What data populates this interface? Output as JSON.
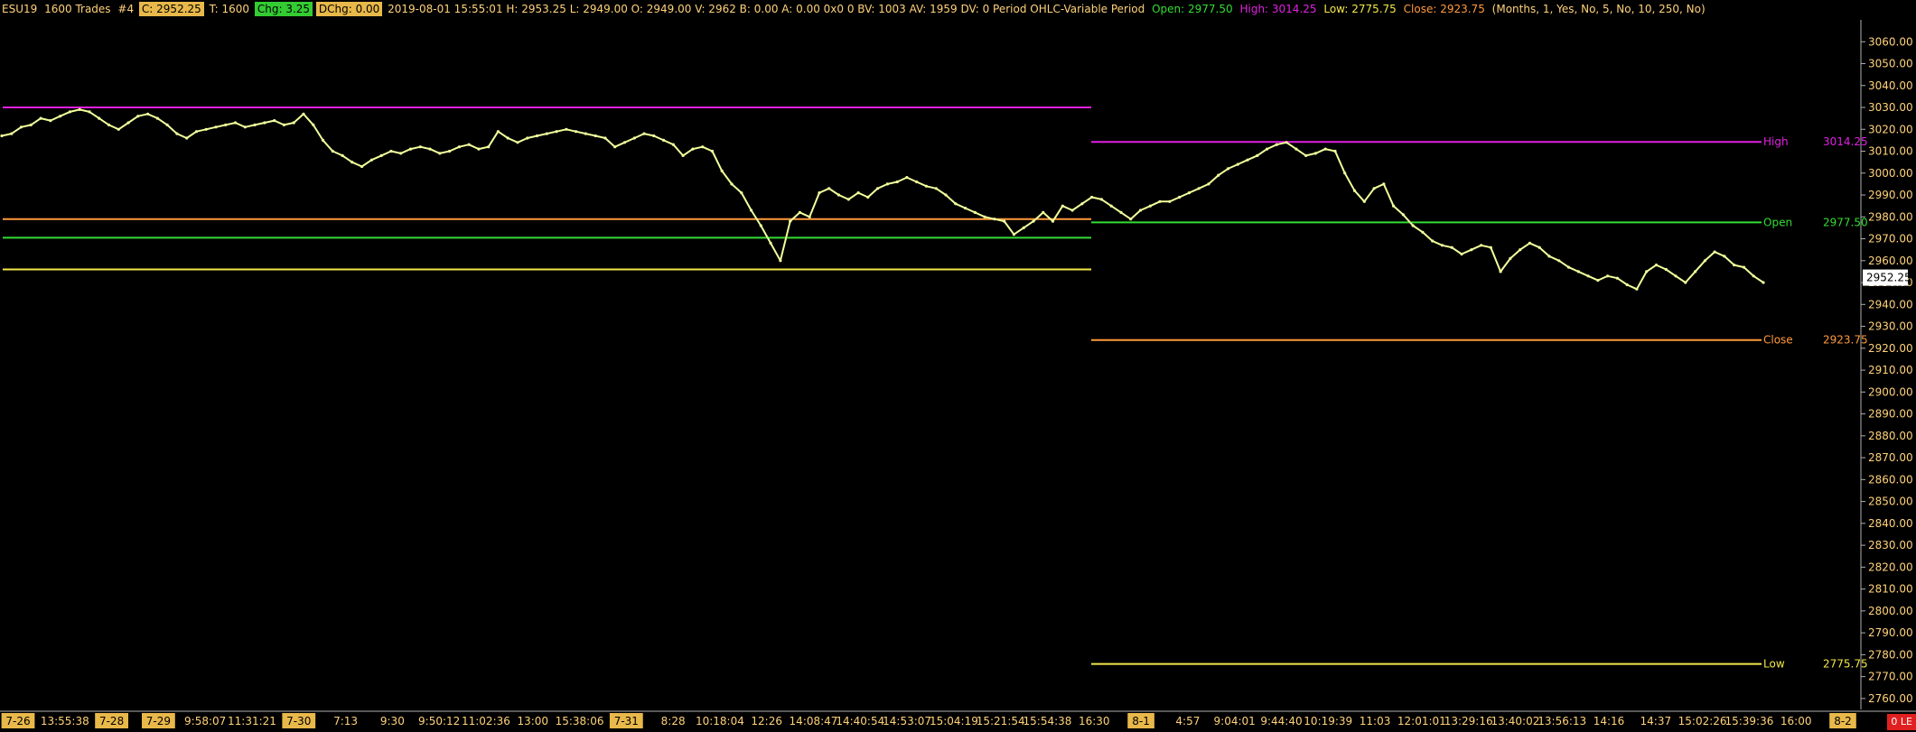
{
  "header": {
    "symbol": "ESU19",
    "trades": "1600 Trades",
    "chart_no": "#4",
    "close": "C: 2952.25",
    "trades_t": "T: 1600",
    "chg": "Chg: 3.25",
    "dchg": "DChg: 0.00",
    "details": "2019-08-01 15:55:01 H: 2953.25 L: 2949.00 O: 2949.00 V: 2962 B: 0.00 A: 0.00 0x0 0 BV: 1003 AV: 1959 DV: 0 Period OHLC-Variable Period",
    "open_label": "Open: 2977.50",
    "high_label": "High: 3014.25",
    "low_label": "Low: 2775.75",
    "close_label": "Close: 2923.75",
    "params": "(Months, 1, Yes, No, 5, No, 10, 250, No)"
  },
  "colors": {
    "background": "#000000",
    "price_line": "#f2ff9c",
    "high": "#e020e0",
    "open": "#33dd33",
    "close": "#ff9a3c",
    "low": "#f2e84a",
    "axis_text": "#ffd27a",
    "date_marker_bg": "#e8b84a"
  },
  "chart_data": {
    "type": "line",
    "ylim": [
      2755,
      3070
    ],
    "y_ticks": [
      2760,
      2770,
      2780,
      2790,
      2800,
      2810,
      2820,
      2830,
      2840,
      2850,
      2860,
      2870,
      2880,
      2890,
      2900,
      2910,
      2920,
      2930,
      2940,
      2950,
      2960,
      2970,
      2980,
      2990,
      3000,
      3010,
      3020,
      3030,
      3040,
      3050,
      3060
    ],
    "current_price": "2952.25",
    "x_labels": [
      {
        "text": "7-26",
        "marker": true
      },
      {
        "text": "13:55:38",
        "marker": false
      },
      {
        "text": "7-28",
        "marker": true
      },
      {
        "text": "7-29",
        "marker": true
      },
      {
        "text": "9:58:07",
        "marker": false
      },
      {
        "text": "11:31:21",
        "marker": false
      },
      {
        "text": "7-30",
        "marker": true
      },
      {
        "text": "7:13",
        "marker": false
      },
      {
        "text": "9:30",
        "marker": false
      },
      {
        "text": "9:50:12",
        "marker": false
      },
      {
        "text": "11:02:36",
        "marker": false
      },
      {
        "text": "13:00",
        "marker": false
      },
      {
        "text": "15:38:06",
        "marker": false
      },
      {
        "text": "7-31",
        "marker": true
      },
      {
        "text": "8:28",
        "marker": false
      },
      {
        "text": "10:18:04",
        "marker": false
      },
      {
        "text": "12:26",
        "marker": false
      },
      {
        "text": "14:08:47",
        "marker": false
      },
      {
        "text": "14:40:54",
        "marker": false
      },
      {
        "text": "14:53:07",
        "marker": false
      },
      {
        "text": "15:04:19",
        "marker": false
      },
      {
        "text": "15:21:54",
        "marker": false
      },
      {
        "text": "15:54:38",
        "marker": false
      },
      {
        "text": "16:30",
        "marker": false
      },
      {
        "text": "8-1",
        "marker": true
      },
      {
        "text": "4:57",
        "marker": false
      },
      {
        "text": "9:04:01",
        "marker": false
      },
      {
        "text": "9:44:40",
        "marker": false
      },
      {
        "text": "10:19:39",
        "marker": false
      },
      {
        "text": "11:03",
        "marker": false
      },
      {
        "text": "12:01:01",
        "marker": false
      },
      {
        "text": "13:29:16",
        "marker": false
      },
      {
        "text": "13:40:02",
        "marker": false
      },
      {
        "text": "13:56:13",
        "marker": false
      },
      {
        "text": "14:16",
        "marker": false
      },
      {
        "text": "14:37",
        "marker": false
      },
      {
        "text": "15:02:26",
        "marker": false
      },
      {
        "text": "15:39:36",
        "marker": false
      },
      {
        "text": "16:00",
        "marker": false
      },
      {
        "text": "8-2",
        "marker": true
      }
    ],
    "series": [
      {
        "values": [
          3017,
          3018,
          3021,
          3022,
          3025,
          3024,
          3026,
          3028,
          3029,
          3028,
          3025,
          3022,
          3020,
          3023,
          3026,
          3027,
          3025,
          3022,
          3018,
          3016,
          3019,
          3020,
          3021,
          3022,
          3023,
          3021,
          3022,
          3023,
          3024,
          3022,
          3023,
          3027,
          3022,
          3015,
          3010,
          3008,
          3005,
          3003,
          3006,
          3008,
          3010,
          3009,
          3011,
          3012,
          3011,
          3009,
          3010,
          3012,
          3013,
          3011,
          3012,
          3019,
          3016,
          3014,
          3016,
          3017,
          3018,
          3019,
          3020,
          3019,
          3018,
          3017,
          3016,
          3012,
          3014,
          3016,
          3018,
          3017,
          3015,
          3013,
          3008,
          3011,
          3012,
          3010,
          3001,
          2995,
          2991,
          2983,
          2976,
          2968,
          2960,
          2978,
          2982,
          2980,
          2991,
          2993,
          2990,
          2988,
          2991,
          2989,
          2993,
          2995,
          2996,
          2998,
          2996,
          2994,
          2993,
          2990,
          2986,
          2984,
          2982,
          2980,
          2979,
          2978,
          2972,
          2975,
          2978,
          2982,
          2978,
          2985,
          2983,
          2986,
          2989,
          2988,
          2985,
          2982,
          2979,
          2983,
          2985,
          2987,
          2987,
          2989,
          2991,
          2993,
          2995,
          2999,
          3002,
          3004,
          3006,
          3008,
          3011,
          3013,
          3014,
          3011,
          3008,
          3009,
          3011,
          3010,
          3000,
          2992,
          2987,
          2993,
          2995,
          2985,
          2981,
          2976,
          2973,
          2969,
          2967,
          2966,
          2963,
          2965,
          2967,
          2966,
          2955,
          2961,
          2965,
          2968,
          2966,
          2962,
          2960,
          2957,
          2955,
          2953,
          2951,
          2953,
          2952,
          2949,
          2947,
          2955,
          2958,
          2956,
          2953,
          2950,
          2955,
          2960,
          2964,
          2962,
          2958,
          2957,
          2953,
          2950
        ]
      }
    ],
    "levels": [
      {
        "key": "high",
        "value": 3014.25,
        "prev_value": 3030.0,
        "label": "High",
        "price": "3014.25"
      },
      {
        "key": "open",
        "value": 2977.5,
        "prev_value": 2970.5,
        "label": "Open",
        "price": "2977.50"
      },
      {
        "key": "close",
        "value": 2923.75,
        "prev_value": 2979.0,
        "label": "Close",
        "price": "2923.75"
      },
      {
        "key": "low",
        "value": 2775.75,
        "prev_value": 2956.0,
        "label": "Low",
        "price": "2775.75"
      }
    ]
  },
  "status": {
    "badge": "0 LE"
  }
}
